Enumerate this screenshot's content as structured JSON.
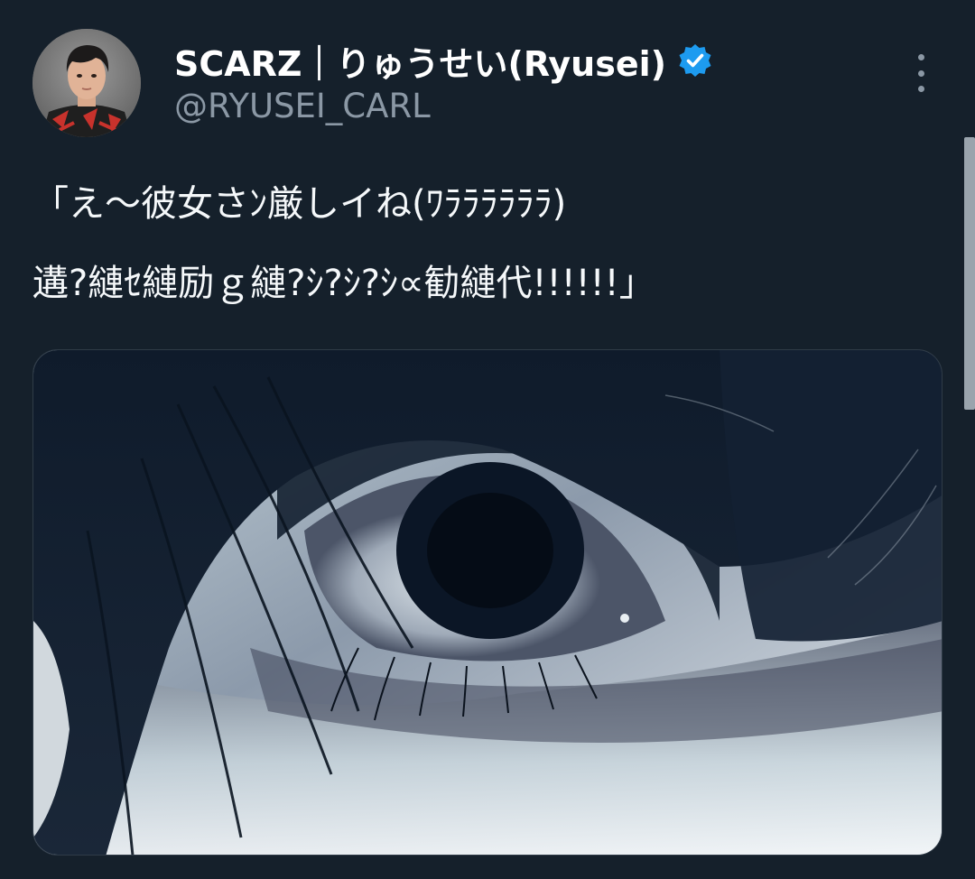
{
  "author": {
    "display_name": "SCARZ｜りゅうせい(Ryusei)",
    "handle": "@RYUSEI_CARL",
    "verified": true,
    "verified_badge_color": "#1d9bf0"
  },
  "tweet": {
    "text_lines": [
      "「え〜彼女さﾝ厳しイね(ﾜﾗﾗﾗﾗﾗﾗ)",
      "遘?縺ｾ縺励ｇ縺?ｼ?ｼ?ｼ∝勧縺代!!!!!!」"
    ],
    "has_media": true,
    "media_description_icon": "photo-eye-closeup"
  },
  "ui": {
    "more_icon": "more-vertical-icon",
    "background_color": "#15202b",
    "secondary_text_color": "#8b98a5"
  }
}
